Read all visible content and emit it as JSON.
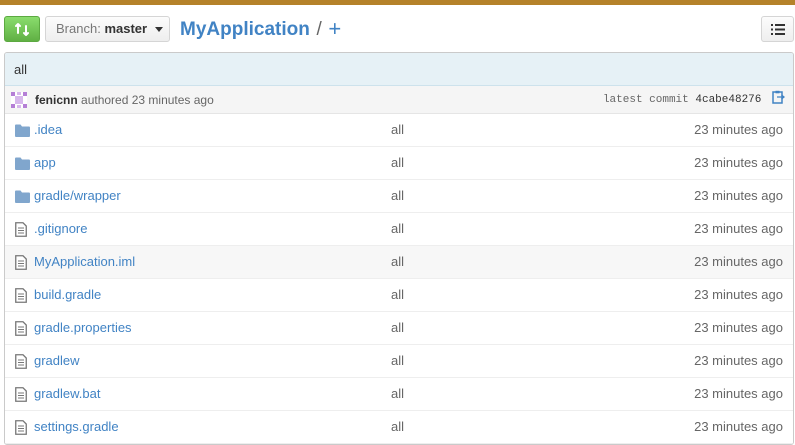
{
  "toolbar": {
    "branch_prefix": "Branch:",
    "branch_name": "master",
    "repo_name": "MyApplication",
    "separator": "/",
    "new_file": "+"
  },
  "commit": {
    "message": "all",
    "author": "fenicnn",
    "authored_text": "authored 23 minutes ago",
    "latest_label": "latest commit",
    "sha": "4cabe48276"
  },
  "files": [
    {
      "name": ".idea",
      "type": "folder",
      "message": "all",
      "age": "23 minutes ago"
    },
    {
      "name": "app",
      "type": "folder",
      "message": "all",
      "age": "23 minutes ago"
    },
    {
      "name": "gradle/wrapper",
      "type": "folder",
      "message": "all",
      "age": "23 minutes ago"
    },
    {
      "name": ".gitignore",
      "type": "file",
      "message": "all",
      "age": "23 minutes ago"
    },
    {
      "name": "MyApplication.iml",
      "type": "file",
      "message": "all",
      "age": "23 minutes ago"
    },
    {
      "name": "build.gradle",
      "type": "file",
      "message": "all",
      "age": "23 minutes ago"
    },
    {
      "name": "gradle.properties",
      "type": "file",
      "message": "all",
      "age": "23 minutes ago"
    },
    {
      "name": "gradlew",
      "type": "file",
      "message": "all",
      "age": "23 minutes ago"
    },
    {
      "name": "gradlew.bat",
      "type": "file",
      "message": "all",
      "age": "23 minutes ago"
    },
    {
      "name": "settings.gradle",
      "type": "file",
      "message": "all",
      "age": "23 minutes ago"
    }
  ],
  "colors": {
    "accent": "#4183c4",
    "header_stripe": "#b5822a",
    "compare_green": "#60b044",
    "folder": "#80a6cd"
  },
  "icons": {
    "compare": "compare-icon",
    "list": "list-icon",
    "folder": "folder-icon",
    "file": "file-text-icon",
    "clipboard": "clipboard-icon"
  }
}
